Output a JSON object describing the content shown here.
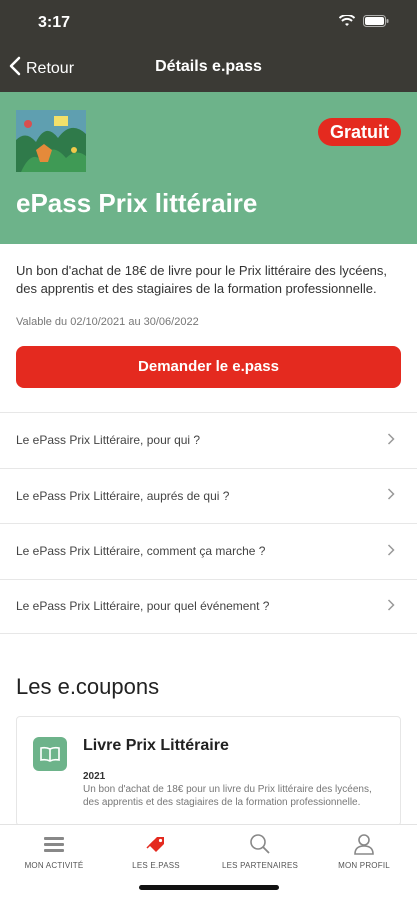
{
  "status_bar": {
    "time": "3:17"
  },
  "nav": {
    "back_label": "Retour",
    "title": "Détails e.pass"
  },
  "hero": {
    "badge": "Gratuit",
    "title": "ePass Prix littéraire"
  },
  "description": "Un bon d'achat de 18€ de livre pour le Prix littéraire des lycéens, des apprentis et des stagiaires de la formation professionnelle.",
  "validity": {
    "text": "Valable du 02/10/2021  au 30/06/2022"
  },
  "cta_label": "Demander le e.pass",
  "faq": [
    {
      "label": "Le ePass Prix Littéraire, pour qui ?"
    },
    {
      "label": "Le ePass Prix Littéraire, auprés de qui ?"
    },
    {
      "label": "Le ePass Prix Littéraire, comment ça marche ?"
    },
    {
      "label": "Le ePass Prix Littéraire, pour quel événement ?"
    }
  ],
  "coupons": {
    "section_title": "Les e.coupons",
    "items": [
      {
        "title": "Livre Prix Littéraire",
        "year": "2021",
        "description": "Un bon d'achat de 18€ pour un livre du Prix littéraire des lycéens, des apprentis et des stagiaires de la formation professionnelle."
      }
    ]
  },
  "tabs": [
    {
      "label": "MON ACTIVITÉ",
      "icon": "activity-icon"
    },
    {
      "label": "LES E.PASS",
      "icon": "ticket-icon",
      "active": true
    },
    {
      "label": "LES PARTENAIRES",
      "icon": "search-icon"
    },
    {
      "label": "MON PROFIL",
      "icon": "profile-icon"
    }
  ],
  "colors": {
    "accent_red": "#e42a1f",
    "header_green": "#6db38a",
    "topbar": "#3b3a35"
  }
}
